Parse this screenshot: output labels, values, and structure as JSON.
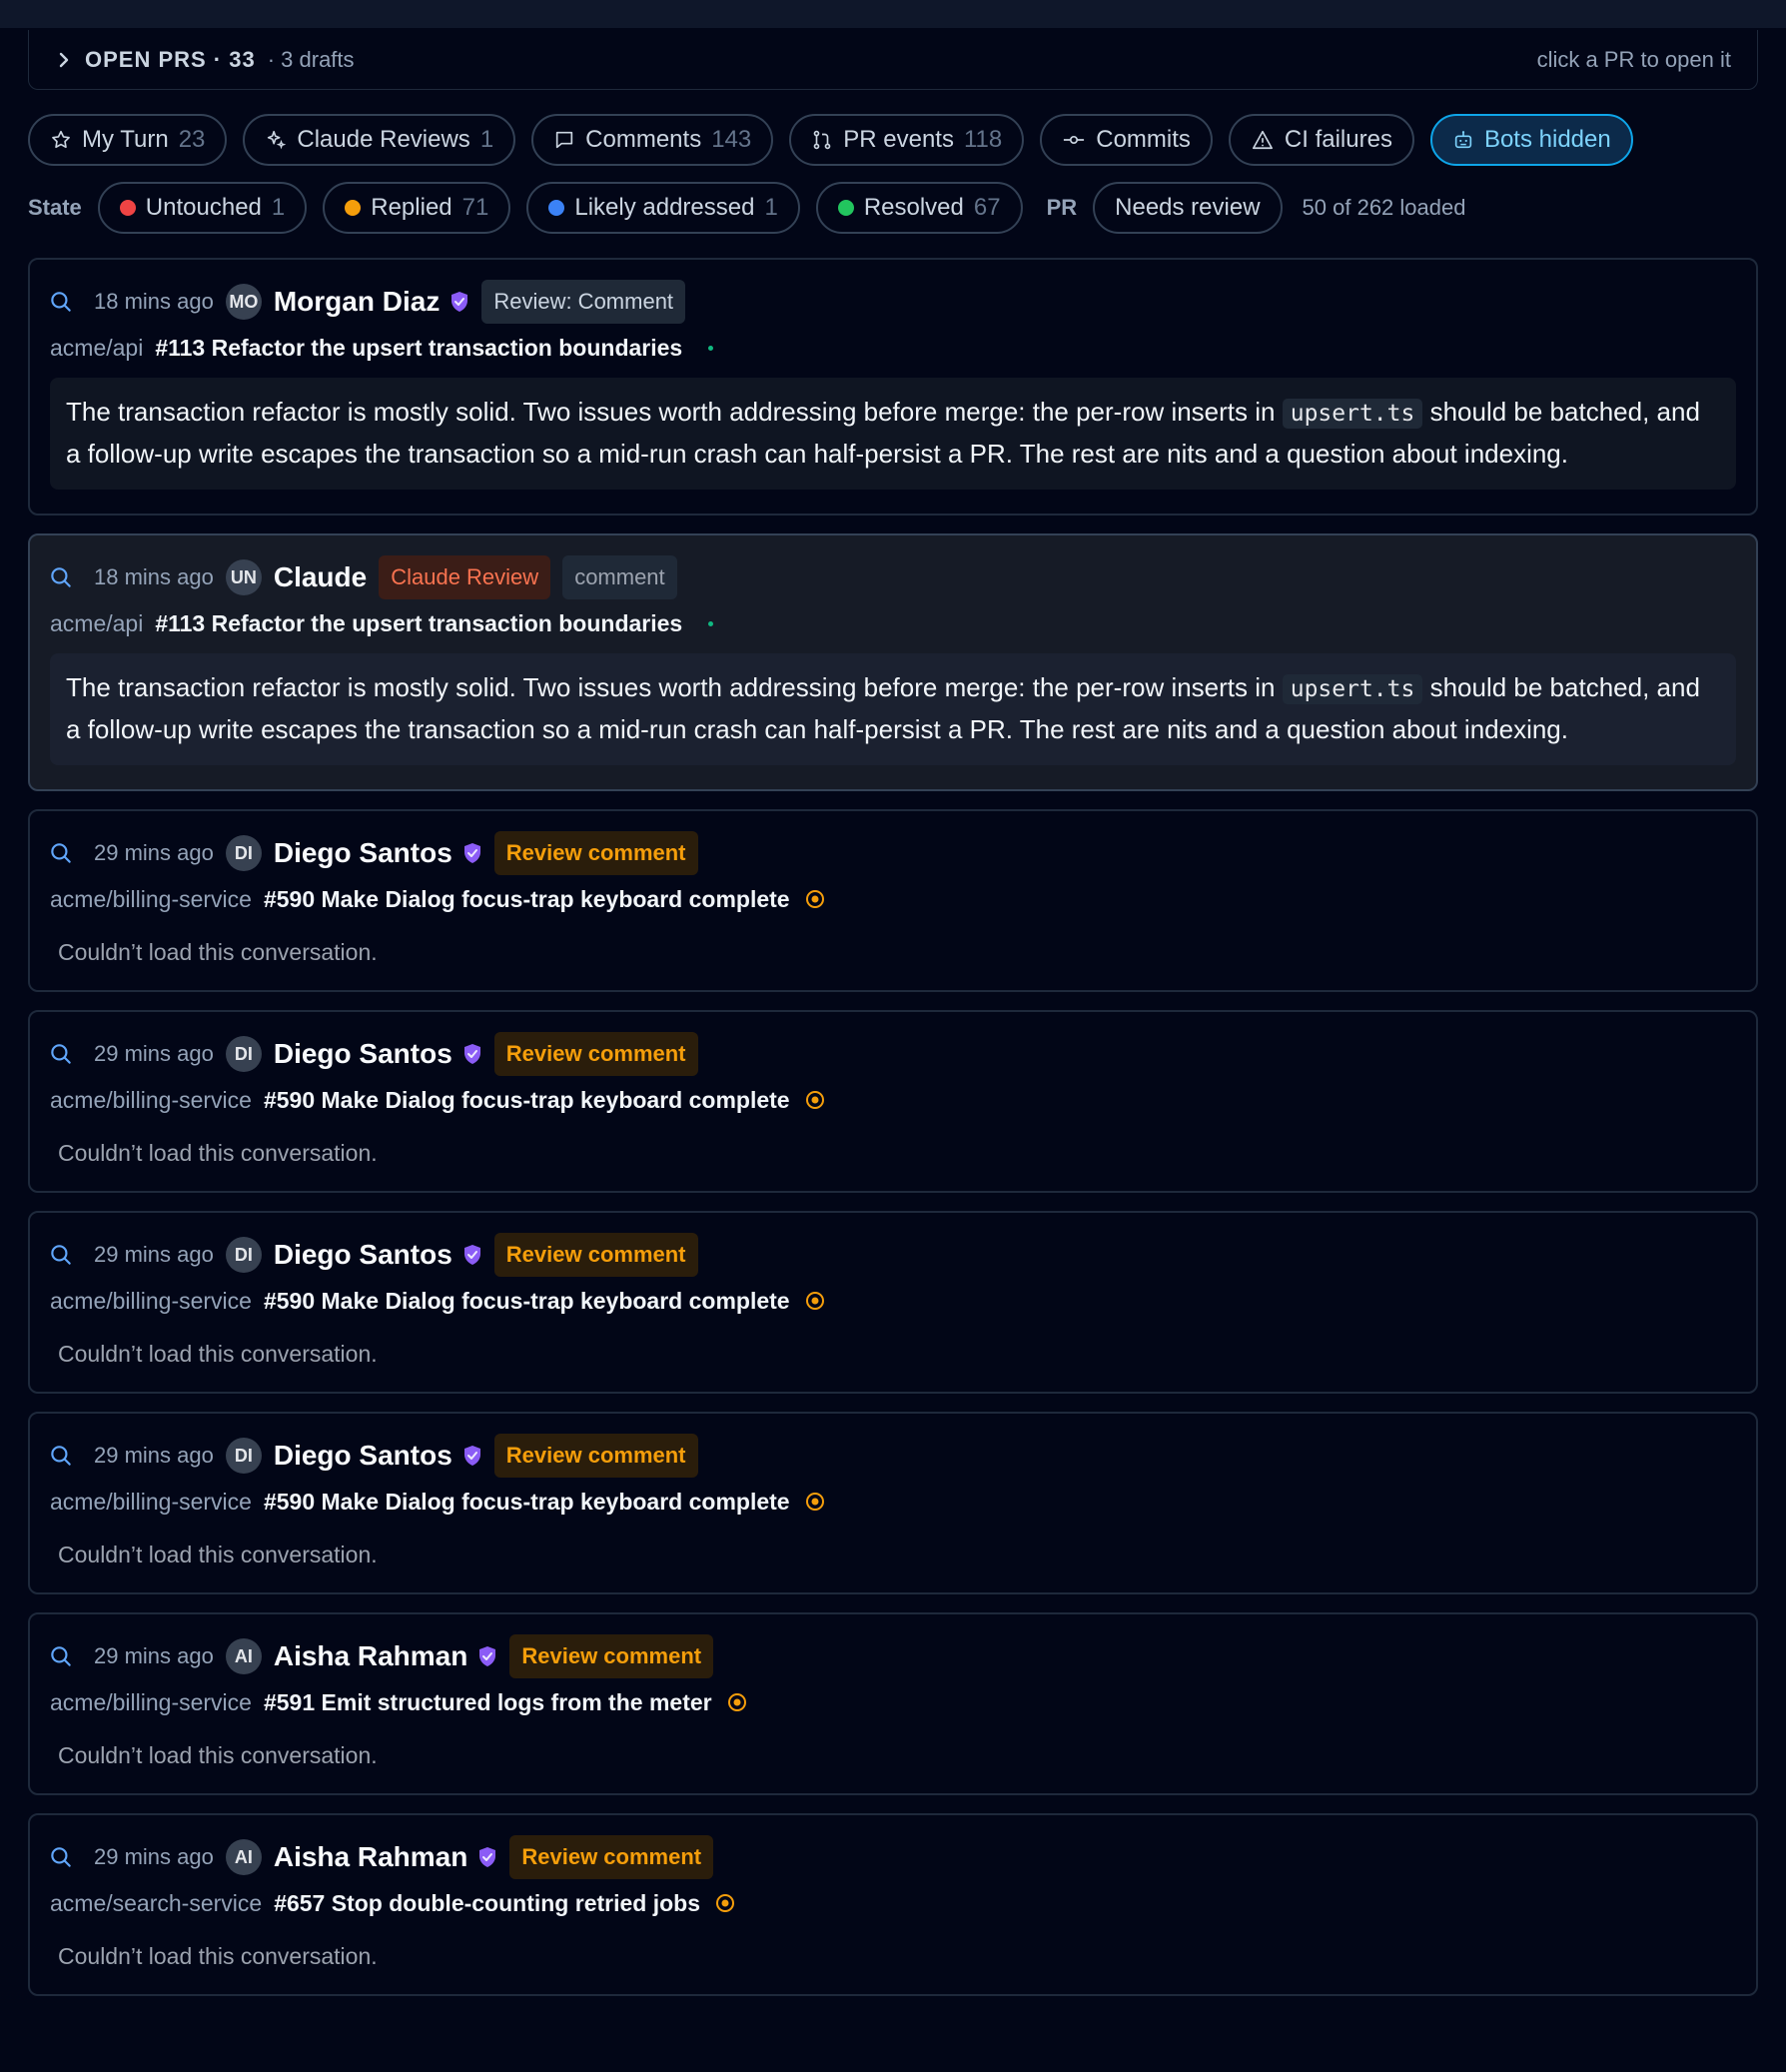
{
  "header": {
    "title": "OPEN PRS · 33",
    "drafts": "· 3 drafts",
    "hint": "click a PR to open it"
  },
  "filters": [
    {
      "label": "My Turn",
      "count": "23",
      "icon": "star-icon"
    },
    {
      "label": "Claude Reviews",
      "count": "1",
      "icon": "sparkle-icon"
    },
    {
      "label": "Comments",
      "count": "143",
      "icon": "comment-icon"
    },
    {
      "label": "PR events",
      "count": "118",
      "icon": "git-pr-icon"
    },
    {
      "label": "Commits",
      "count": "",
      "icon": "commit-icon"
    },
    {
      "label": "CI failures",
      "count": "",
      "icon": "warning-icon"
    },
    {
      "label": "Bots hidden",
      "count": "",
      "icon": "bot-icon",
      "active": true
    }
  ],
  "state": {
    "label": "State",
    "items": [
      {
        "label": "Untouched",
        "count": "1",
        "color": "#ef4444"
      },
      {
        "label": "Replied",
        "count": "71",
        "color": "#f59e0b"
      },
      {
        "label": "Likely addressed",
        "count": "1",
        "color": "#3b82f6"
      },
      {
        "label": "Resolved",
        "count": "67",
        "color": "#22c55e"
      }
    ],
    "pr_label": "PR",
    "pr_filter": "Needs review",
    "loaded": "50 of 262 loaded"
  },
  "colors": {
    "accent": "#0ea5e9",
    "verified": "#8b5cf6",
    "review_badge": "#f59e0b",
    "claude_badge": "#f97350"
  },
  "cards": [
    {
      "time": "18 mins ago",
      "initials": "MO",
      "author": "Morgan Diaz",
      "verified": true,
      "badges": [
        {
          "text": "Review: Comment",
          "style": "grey"
        }
      ],
      "repo": "acme/api",
      "pr": "#113 Refactor the upsert transaction boundaries",
      "status": "dot",
      "body_before": "The transaction refactor is mostly solid. Two issues worth addressing before merge: the per-row inserts in ",
      "body_code": "upsert.ts",
      "body_after": " should be batched, and a follow-up write escapes the transaction so a mid-run crash can half-persist a PR. The rest are nits and a question about indexing.",
      "highlight": false
    },
    {
      "time": "18 mins ago",
      "initials": "UN",
      "author": "Claude",
      "verified": false,
      "badges": [
        {
          "text": "Claude Review",
          "style": "claude"
        },
        {
          "text": "comment",
          "style": "comment"
        }
      ],
      "repo": "acme/api",
      "pr": "#113 Refactor the upsert transaction boundaries",
      "status": "dot",
      "body_before": "The transaction refactor is mostly solid. Two issues worth addressing before merge: the per-row inserts in ",
      "body_code": "upsert.ts",
      "body_after": " should be batched, and a follow-up write escapes the transaction so a mid-run crash can half-persist a PR. The rest are nits and a question about indexing.",
      "highlight": true
    },
    {
      "time": "29 mins ago",
      "initials": "DI",
      "author": "Diego Santos",
      "verified": true,
      "badges": [
        {
          "text": "Review comment",
          "style": "review"
        }
      ],
      "repo": "acme/billing-service",
      "pr": "#590 Make Dialog focus-trap keyboard complete",
      "status": "target",
      "error": "Couldn’t load this conversation."
    },
    {
      "time": "29 mins ago",
      "initials": "DI",
      "author": "Diego Santos",
      "verified": true,
      "badges": [
        {
          "text": "Review comment",
          "style": "review"
        }
      ],
      "repo": "acme/billing-service",
      "pr": "#590 Make Dialog focus-trap keyboard complete",
      "status": "target",
      "error": "Couldn’t load this conversation."
    },
    {
      "time": "29 mins ago",
      "initials": "DI",
      "author": "Diego Santos",
      "verified": true,
      "badges": [
        {
          "text": "Review comment",
          "style": "review"
        }
      ],
      "repo": "acme/billing-service",
      "pr": "#590 Make Dialog focus-trap keyboard complete",
      "status": "target",
      "error": "Couldn’t load this conversation."
    },
    {
      "time": "29 mins ago",
      "initials": "DI",
      "author": "Diego Santos",
      "verified": true,
      "badges": [
        {
          "text": "Review comment",
          "style": "review"
        }
      ],
      "repo": "acme/billing-service",
      "pr": "#590 Make Dialog focus-trap keyboard complete",
      "status": "target",
      "error": "Couldn’t load this conversation."
    },
    {
      "time": "29 mins ago",
      "initials": "AI",
      "author": "Aisha Rahman",
      "verified": true,
      "badges": [
        {
          "text": "Review comment",
          "style": "review"
        }
      ],
      "repo": "acme/billing-service",
      "pr": "#591 Emit structured logs from the meter",
      "status": "target",
      "error": "Couldn’t load this conversation."
    },
    {
      "time": "29 mins ago",
      "initials": "AI",
      "author": "Aisha Rahman",
      "verified": true,
      "badges": [
        {
          "text": "Review comment",
          "style": "review"
        }
      ],
      "repo": "acme/search-service",
      "pr": "#657 Stop double-counting retried jobs",
      "status": "target",
      "error": "Couldn’t load this conversation."
    }
  ]
}
